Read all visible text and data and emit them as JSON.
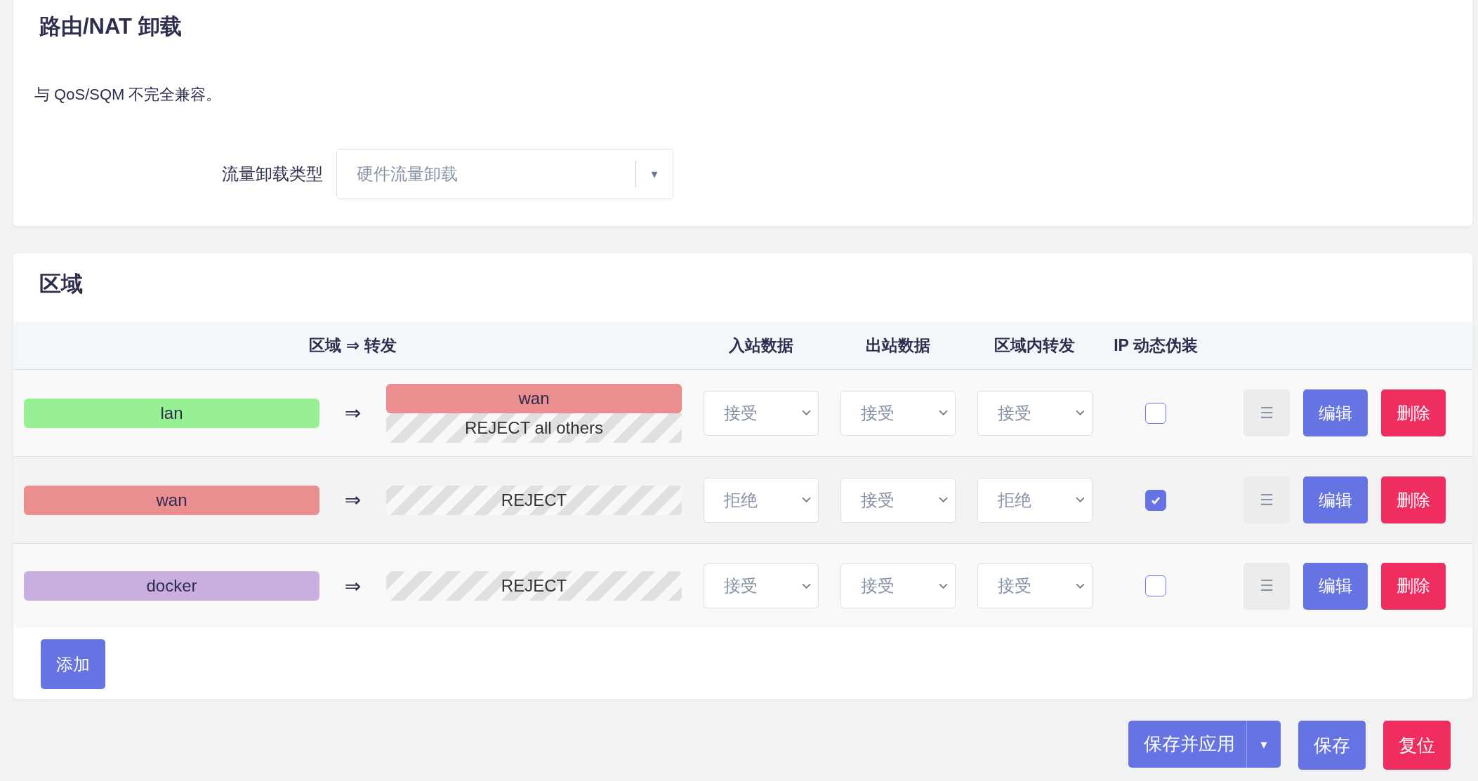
{
  "offload": {
    "title": "路由/NAT 卸载",
    "note": "与 QoS/SQM 不完全兼容。",
    "field": {
      "label": "流量卸载类型",
      "value": "硬件流量卸载",
      "arrow": "▾"
    }
  },
  "zones": {
    "title": "区域",
    "columns": [
      "区域 ⇒ 转发",
      "入站数据",
      "出站数据",
      "区域内转发",
      "IP 动态伪装"
    ],
    "rows": [
      {
        "zone": {
          "name": "lan",
          "color": "#97f092"
        },
        "arrow": "⇒",
        "forwards": [
          {
            "kind": "zone",
            "name": "wan",
            "color": "#eb8e90"
          },
          {
            "kind": "policy",
            "name": "REJECT all others"
          }
        ],
        "input": "接受",
        "output": "接受",
        "forward": "接受",
        "masq": false,
        "menu": "☰",
        "edit": "编辑",
        "delete": "删除"
      },
      {
        "zone": {
          "name": "wan",
          "color": "#eb8e90"
        },
        "arrow": "⇒",
        "forwards": [
          {
            "kind": "policy",
            "name": "REJECT"
          }
        ],
        "input": "拒绝",
        "output": "接受",
        "forward": "拒绝",
        "masq": true,
        "menu": "☰",
        "edit": "编辑",
        "delete": "删除"
      },
      {
        "zone": {
          "name": "docker",
          "color": "#c9aee0"
        },
        "arrow": "⇒",
        "forwards": [
          {
            "kind": "policy",
            "name": "REJECT"
          }
        ],
        "input": "接受",
        "output": "接受",
        "forward": "接受",
        "masq": false,
        "menu": "☰",
        "edit": "编辑",
        "delete": "删除"
      }
    ],
    "add": "添加"
  },
  "footer": {
    "save_apply": "保存并应用",
    "save_apply_arrow": "▾",
    "save": "保存",
    "reset": "复位"
  }
}
